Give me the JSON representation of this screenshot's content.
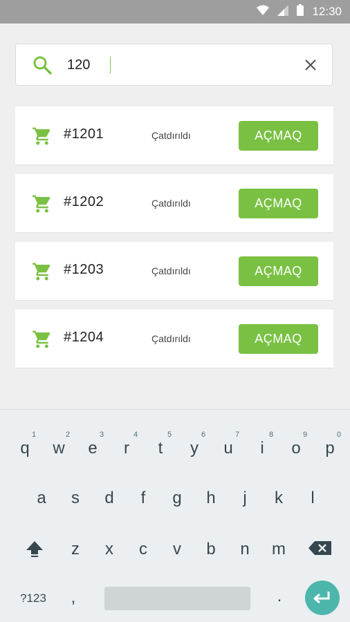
{
  "status_bar": {
    "time": "12:30",
    "icons": [
      "wifi-icon",
      "signal-icon",
      "battery-icon"
    ]
  },
  "search": {
    "value": "120",
    "icon": "search-icon",
    "clear_icon": "close-icon"
  },
  "orders": [
    {
      "id": "#1201",
      "status": "Çatdırıldı",
      "action": "AÇMAQ"
    },
    {
      "id": "#1202",
      "status": "Çatdırıldı",
      "action": "AÇMAQ"
    },
    {
      "id": "#1203",
      "status": "Çatdırıldı",
      "action": "AÇMAQ"
    },
    {
      "id": "#1204",
      "status": "Çatdırıldı",
      "action": "AÇMAQ"
    }
  ],
  "keyboard": {
    "row1": [
      "q",
      "w",
      "e",
      "r",
      "t",
      "y",
      "u",
      "i",
      "o",
      "p"
    ],
    "row1_nums": [
      "1",
      "2",
      "3",
      "4",
      "5",
      "6",
      "7",
      "8",
      "9",
      "0"
    ],
    "row2": [
      "a",
      "s",
      "d",
      "f",
      "g",
      "h",
      "j",
      "k",
      "l"
    ],
    "row3": [
      "z",
      "x",
      "c",
      "v",
      "b",
      "n",
      "m"
    ],
    "symbols_key": "?123",
    "comma": ",",
    "period": ".",
    "shift_icon": "shift-icon",
    "backspace_icon": "backspace-icon",
    "enter_icon": "enter-icon"
  },
  "colors": {
    "accent": "#7ac143",
    "status_bar": "#9e9e9e",
    "enter_key": "#4db6ac"
  }
}
